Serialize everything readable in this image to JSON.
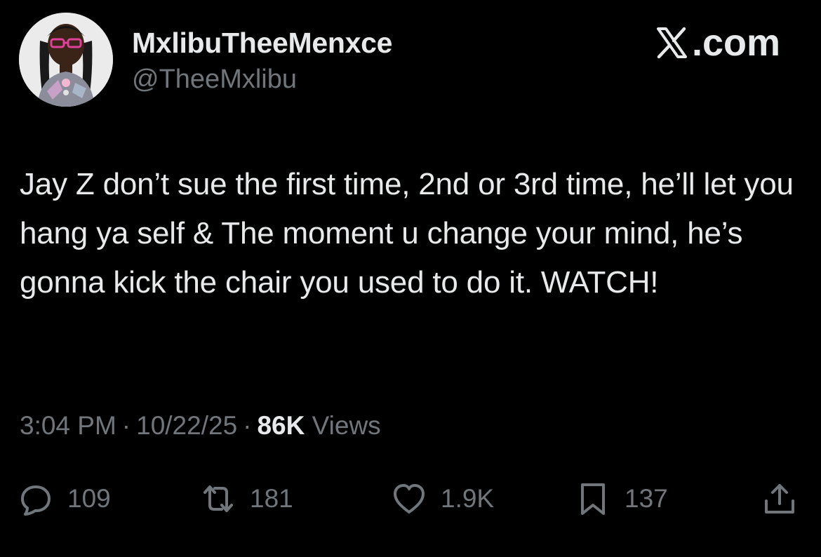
{
  "author": {
    "display_name": "MxlibuTheeMenxce",
    "handle": "@TheeMxlibu"
  },
  "brand": {
    "label": ".com",
    "logo_icon": "x-logo-icon"
  },
  "tweet": {
    "text": "Jay Z don’t sue the first time, 2nd or 3rd time, he’ll let you hang ya self & The moment u change your mind, he’s gonna kick the chair you used to do it. WATCH!"
  },
  "meta": {
    "time": "3:04 PM",
    "separator": "·",
    "date": "10/22/25",
    "views_count": "86K",
    "views_label": "Views"
  },
  "actions": {
    "replies": {
      "icon": "reply-icon",
      "count": "109"
    },
    "reposts": {
      "icon": "repost-icon",
      "count": "181"
    },
    "likes": {
      "icon": "heart-icon",
      "count": "1.9K"
    },
    "bookmarks": {
      "icon": "bookmark-icon",
      "count": "137"
    },
    "share": {
      "icon": "share-icon"
    }
  },
  "colors": {
    "background": "#000000",
    "primary_text": "#e7e9ea",
    "secondary_text": "#71767b"
  }
}
